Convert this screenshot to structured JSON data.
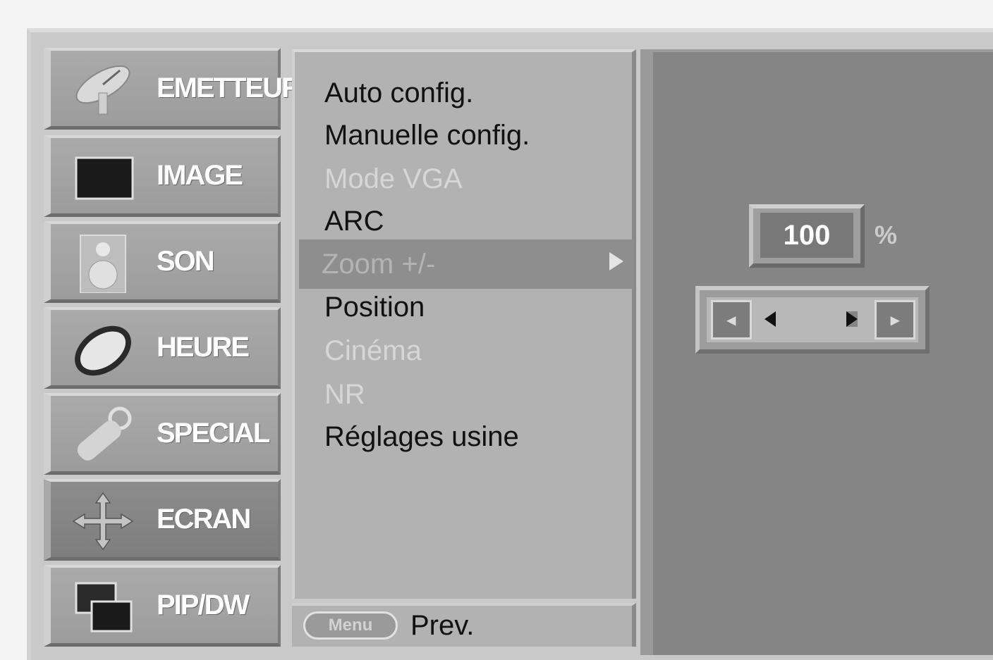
{
  "tabs": [
    {
      "label": "EMETTEUR",
      "icon": "satellite-dish-icon",
      "active": false
    },
    {
      "label": "IMAGE",
      "icon": "picture-icon",
      "active": false
    },
    {
      "label": "SON",
      "icon": "speaker-icon",
      "active": false
    },
    {
      "label": "HEURE",
      "icon": "clock-icon",
      "active": false
    },
    {
      "label": "SPECIAL",
      "icon": "key-icon",
      "active": false
    },
    {
      "label": "ECRAN",
      "icon": "move-arrows-icon",
      "active": true
    },
    {
      "label": "PIP/DW",
      "icon": "pip-windows-icon",
      "active": false
    }
  ],
  "submenu": {
    "items": [
      {
        "label": "Auto config.",
        "state": "enabled"
      },
      {
        "label": "Manuelle config.",
        "state": "enabled"
      },
      {
        "label": "Mode VGA",
        "state": "disabled"
      },
      {
        "label": "ARC",
        "state": "enabled"
      },
      {
        "label": "Zoom +/-",
        "state": "selected"
      },
      {
        "label": "Position",
        "state": "enabled"
      },
      {
        "label": "Cinéma",
        "state": "disabled"
      },
      {
        "label": "NR",
        "state": "disabled"
      },
      {
        "label": "Réglages usine",
        "state": "enabled"
      }
    ]
  },
  "bottom": {
    "menu_key": "Menu",
    "prev_label": "Prev."
  },
  "zoom": {
    "value": "100",
    "unit": "%",
    "left_end": "◂",
    "right_end": "▸"
  },
  "colors": {
    "panel": "#b2b2b2",
    "active_tab": "#7e7e7e",
    "right_panel": "#858585"
  }
}
